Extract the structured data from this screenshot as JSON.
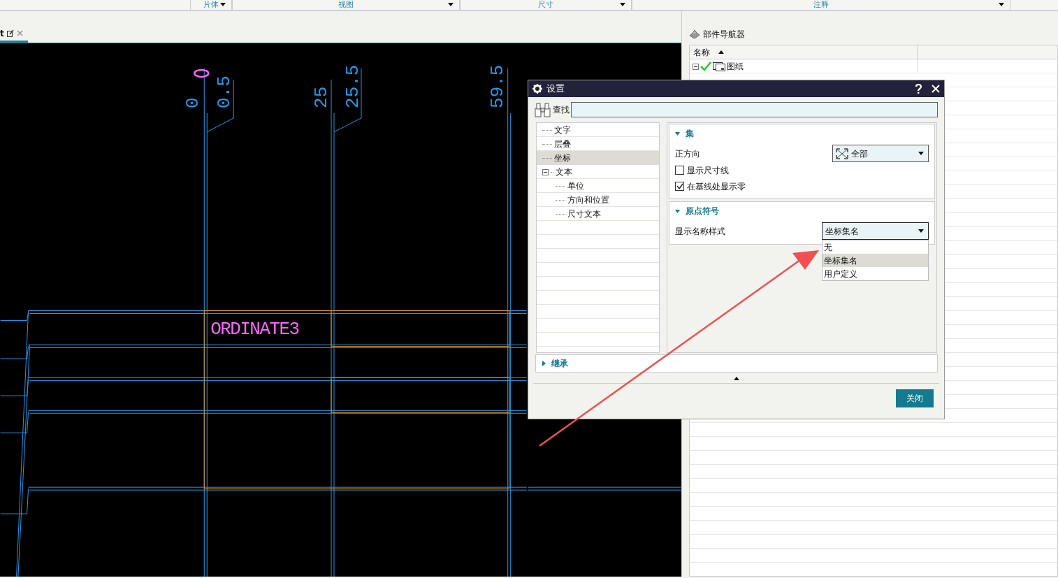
{
  "ribbon_groups": [
    {
      "label": "片体"
    },
    {
      "label": "视图"
    },
    {
      "label": "尺寸"
    },
    {
      "label": "注释"
    }
  ],
  "document_tab": {
    "label": "t",
    "selected": true
  },
  "drawing": {
    "dimension_labels": [
      "0",
      "0.5",
      "25",
      "25.5",
      "59.5"
    ],
    "table_text": "ORDINATE3"
  },
  "navigator": {
    "title": "部件导航器",
    "columns": [
      "名称"
    ],
    "tree": [
      {
        "label": "图纸",
        "expanded": true,
        "checked": true
      }
    ]
  },
  "dialog": {
    "title": "设置",
    "search": {
      "label": "查找"
    },
    "tree": [
      {
        "label": "文字",
        "selected": false
      },
      {
        "label": "层叠",
        "selected": false
      },
      {
        "label": "坐标",
        "selected": true
      },
      {
        "label": "文本",
        "selected": false,
        "expanded": true,
        "children": [
          {
            "label": "单位",
            "selected": false
          },
          {
            "label": "方向和位置",
            "selected": false
          },
          {
            "label": "尺寸文本",
            "selected": false
          }
        ]
      }
    ],
    "sections": [
      {
        "title": "集",
        "expanded": true,
        "fields": [
          {
            "kind": "dropdown",
            "label": "正方向",
            "value": "全部",
            "open": false
          },
          {
            "kind": "checkbox",
            "label": "显示尺寸线",
            "checked": false
          },
          {
            "kind": "checkbox",
            "label": "在基线处显示零",
            "checked": true
          }
        ]
      },
      {
        "title": "原点符号",
        "expanded": true,
        "fields": [
          {
            "kind": "dropdown",
            "label": "显示名称样式",
            "value": "坐标集名",
            "open": true,
            "options": [
              {
                "label": "无",
                "selected": false
              },
              {
                "label": "坐标集名",
                "selected": true
              },
              {
                "label": "用户定义",
                "selected": false
              }
            ]
          }
        ]
      }
    ],
    "inherit_section": {
      "title": "继承",
      "expanded": false
    },
    "close_button": "关闭"
  }
}
